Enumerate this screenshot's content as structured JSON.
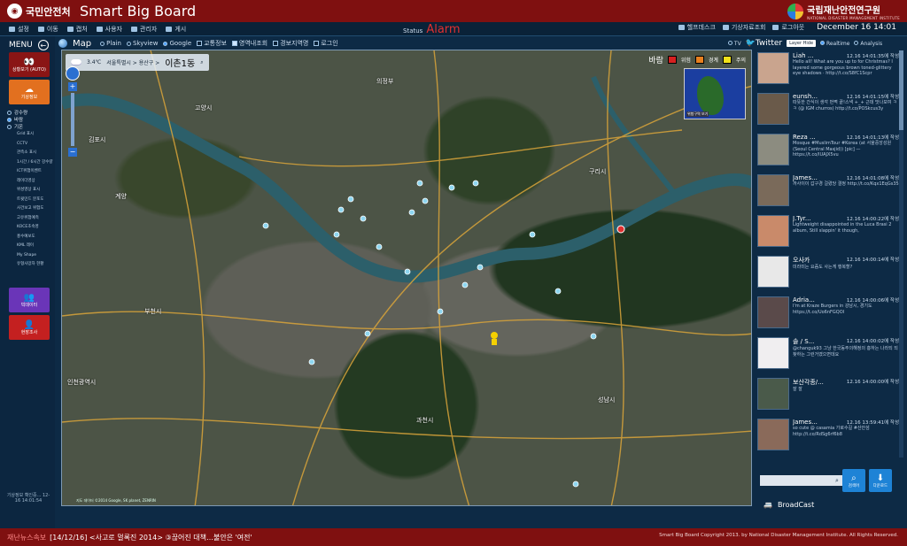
{
  "header": {
    "org_logo_text": "국민안전처",
    "app_title": "Smart Big Board",
    "institute_name": "국립재난안전연구원",
    "institute_sub": "NATIONAL DISASTER MANAGEMENT INSTITUTE"
  },
  "menubar": {
    "items": [
      "설정",
      "이동",
      "캡처",
      "사용자",
      "관리자",
      "게시"
    ],
    "status_label": "Status",
    "status_value": "Alarm",
    "right_items": [
      "헬프데스크",
      "기상자료조회",
      "로그아웃"
    ],
    "date": "December 16 14:01"
  },
  "sidebar": {
    "menu_label": "MENU",
    "auto_tile": "상황보기 (AUTO)",
    "weather_tile": "기상정보",
    "radios": [
      {
        "label": "강수량",
        "checked": false
      },
      {
        "label": "바람",
        "checked": true
      },
      {
        "label": "기온",
        "checked": false
      }
    ],
    "layers": [
      "Grid 표시",
      "CCTV",
      "관측소 표시",
      "1시간 / 6시간 강수량",
      "ICT위험이벤트",
      "레이더영상",
      "위성영상 표시",
      "트윗민드 분포도",
      "사건보고 위험도",
      "고유위험예측",
      "KOCE초속영",
      "홍수예보도",
      "KML 레이",
      "My Shape",
      "유형사망자 현황"
    ],
    "news_tile": "빅데이터",
    "report_tile": "현장조사",
    "footer": "기상정보 확인중... 12-16 14:01:54"
  },
  "map_toolbar": {
    "map_label": "Map",
    "options": [
      {
        "label": "Plain",
        "type": "radio",
        "checked": false
      },
      {
        "label": "Skyview",
        "type": "radio",
        "checked": false
      },
      {
        "label": "Google",
        "type": "radio",
        "checked": true
      },
      {
        "label": "교통정보",
        "type": "check",
        "checked": false
      },
      {
        "label": "영역내조회",
        "type": "check",
        "checked": true
      },
      {
        "label": "경보지역명",
        "type": "check",
        "checked": false
      },
      {
        "label": "로그인",
        "type": "check",
        "checked": false
      }
    ]
  },
  "map": {
    "temperature": "3.4℃",
    "region": "서울특별시 > 용산구 >",
    "location": "이촌1동",
    "legend_title": "바람",
    "legend": [
      {
        "label": "위험",
        "color": "#d62020"
      },
      {
        "label": "경계",
        "color": "#e8801f"
      },
      {
        "label": "주의",
        "color": "#f2e21a"
      }
    ],
    "minimap_label": "위험구역 보기",
    "places": [
      "김포시",
      "구리시",
      "부천시",
      "인천광역시",
      "과천시",
      "성남시",
      "의정부",
      "계양",
      "고양시"
    ],
    "copyright": "지도 데이터 ©2014 Google, SK planet, ZENRIN"
  },
  "twitter": {
    "tabs": [
      "TV",
      "Twitter",
      "Realtime",
      "Analysis"
    ],
    "layer_hide": "Layer Hide",
    "tweets": [
      {
        "user": "Liah ...",
        "time": "12.16 14:01:35에 작성",
        "text": "Hello all! What are you up to for Christmas? I layered some gorgeous brown toned-glittery eye shadows · http://t.co/S8fC1Scpr"
      },
      {
        "user": "eunsh...",
        "time": "12.16 14:01:15에 작성",
        "text": "따뜻한 간식이 생각 번쩍 끝!스낵 +_+ 근데 맛나보여 ㅋㅋ (@ IGM churros) http://t.co/POSkcus3y"
      },
      {
        "user": "Reza ...",
        "time": "12.16 14:01:13에 작성",
        "text": "Mosque #MuslimTour #Korea (at 서울중앙성원 (Seoul Central Masjid)) [pic] — https://t.co/IUAJX5vu"
      },
      {
        "user": "James...",
        "time": "12.16 14:01:08에 작성",
        "text": "까사이이 갑구경 걸렸당 결정 http://t.co/Kqx1EqGs35"
      },
      {
        "user": "J.Tyr...",
        "time": "12.16 14:00:22에 작성",
        "text": "Lightweight disappointed in the Luca Brasi 2 album, Still slappin' it though,"
      },
      {
        "user": "오사카",
        "time": "12.16 14:00:14에 작성",
        "text": "미라미는 요즘도 사는게 행복할?"
      },
      {
        "user": "Adria...",
        "time": "12.16 14:00:06에 작성",
        "text": "I'm at Kraze Burgers in 강남시, 경기도 https://t.co/Uo6nFGQOI"
      },
      {
        "user": "솔 / S...",
        "time": "12.16 14:00:02에 작성",
        "text": "@changuk93 그냥 한국동주의해정의 흥하는 나라되 되찾하는 그런거였으면데요"
      },
      {
        "user": "보산각종/...",
        "time": "12.16 14:00:00에 작성",
        "text": "잘 잘"
      },
      {
        "user": "James...",
        "time": "12.16 13:59:41에 작성",
        "text": "so cute @ casamia 가로수길 #산안섬 http://t.co/RdSg6rf6b8"
      }
    ],
    "search_label": "검색어",
    "download_label": "다운로드",
    "broadcast": "BroadCast"
  },
  "ticker": {
    "label": "재난뉴스속보",
    "text": "[14/12/16] <사고로 멀록진 2014> ③끊어진 대책…불안은 '여전'",
    "copyright": "Smart Big Board Copyright 2013. by National Disaster Management Institute. All Rights Reserved."
  }
}
